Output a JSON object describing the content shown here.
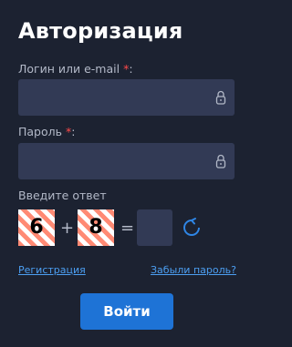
{
  "form": {
    "title": "Авторизация",
    "login_label": "Логин или e-mail",
    "password_label": "Пароль",
    "required_mark": "*",
    "required_colon": ":",
    "login_value": "",
    "password_value": ""
  },
  "captcha": {
    "label": "Введите ответ",
    "digit1": "6",
    "operator": "+",
    "digit2": "8",
    "equals": "=",
    "answer_value": ""
  },
  "links": {
    "register": "Регистрация",
    "forgot": "Забыли пароль?"
  },
  "submit": {
    "label": "Войти"
  },
  "colors": {
    "background": "#1c2231",
    "field": "#323a55",
    "accent": "#1e73d6",
    "link": "#4c9ff2",
    "required": "#ff4a4a"
  },
  "icons": {
    "login_field_icon": "lock-icon",
    "password_field_icon": "lock-icon",
    "captcha_refresh_icon": "refresh-icon"
  }
}
